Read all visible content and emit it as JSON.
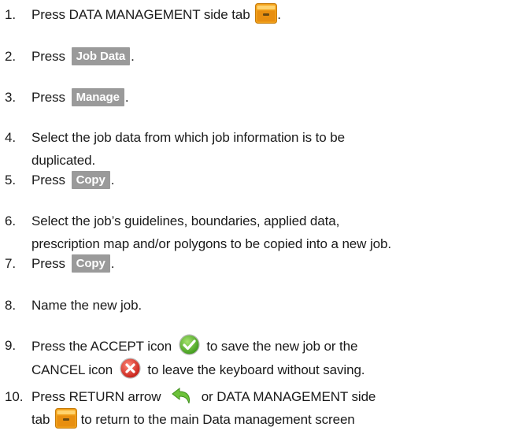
{
  "steps": [
    {
      "num": "1.",
      "pre": "Press DATA MANAGEMENT side tab",
      "post": "."
    },
    {
      "num": "2.",
      "pre": "Press",
      "button": "Job Data",
      "post": "."
    },
    {
      "num": "3.",
      "pre": "Press",
      "button": "Manage",
      "post": "."
    },
    {
      "num": "4.",
      "line1": "Select the job data from which job information is to be",
      "line2": "duplicated."
    },
    {
      "num": "5.",
      "pre": "Press",
      "button": "Copy",
      "post": "."
    },
    {
      "num": "6.",
      "line1": "Select the job’s guidelines, boundaries, applied data,",
      "line2": "prescription map and/or polygons to be copied into a new job."
    },
    {
      "num": "7.",
      "pre": "Press",
      "button": "Copy",
      "post": "."
    },
    {
      "num": "8.",
      "text": "Name the new job."
    },
    {
      "num": "9.",
      "line1_a": "Press the ACCEPT icon",
      "line1_b": "to save the new job or the",
      "line2_a": "CANCEL icon",
      "line2_b": "to leave the keyboard without saving."
    },
    {
      "num": "10.",
      "line1_a": "Press RETURN arrow",
      "line1_b": "or DATA MANAGEMENT side",
      "line2_a": "tab",
      "line2_b": "to return to the main Data management screen"
    }
  ],
  "icons": {
    "data_management_tab": "data-management-tab-icon",
    "accept": "accept-check-icon",
    "cancel": "cancel-x-icon",
    "return": "return-arrow-icon"
  },
  "colors": {
    "button_bg": "#9a9a9a",
    "button_text": "#ffffff",
    "tab_orange": "#f2a21c",
    "accept_green": "#5cb82c",
    "cancel_red": "#e0342a",
    "return_green": "#6cc23a"
  }
}
